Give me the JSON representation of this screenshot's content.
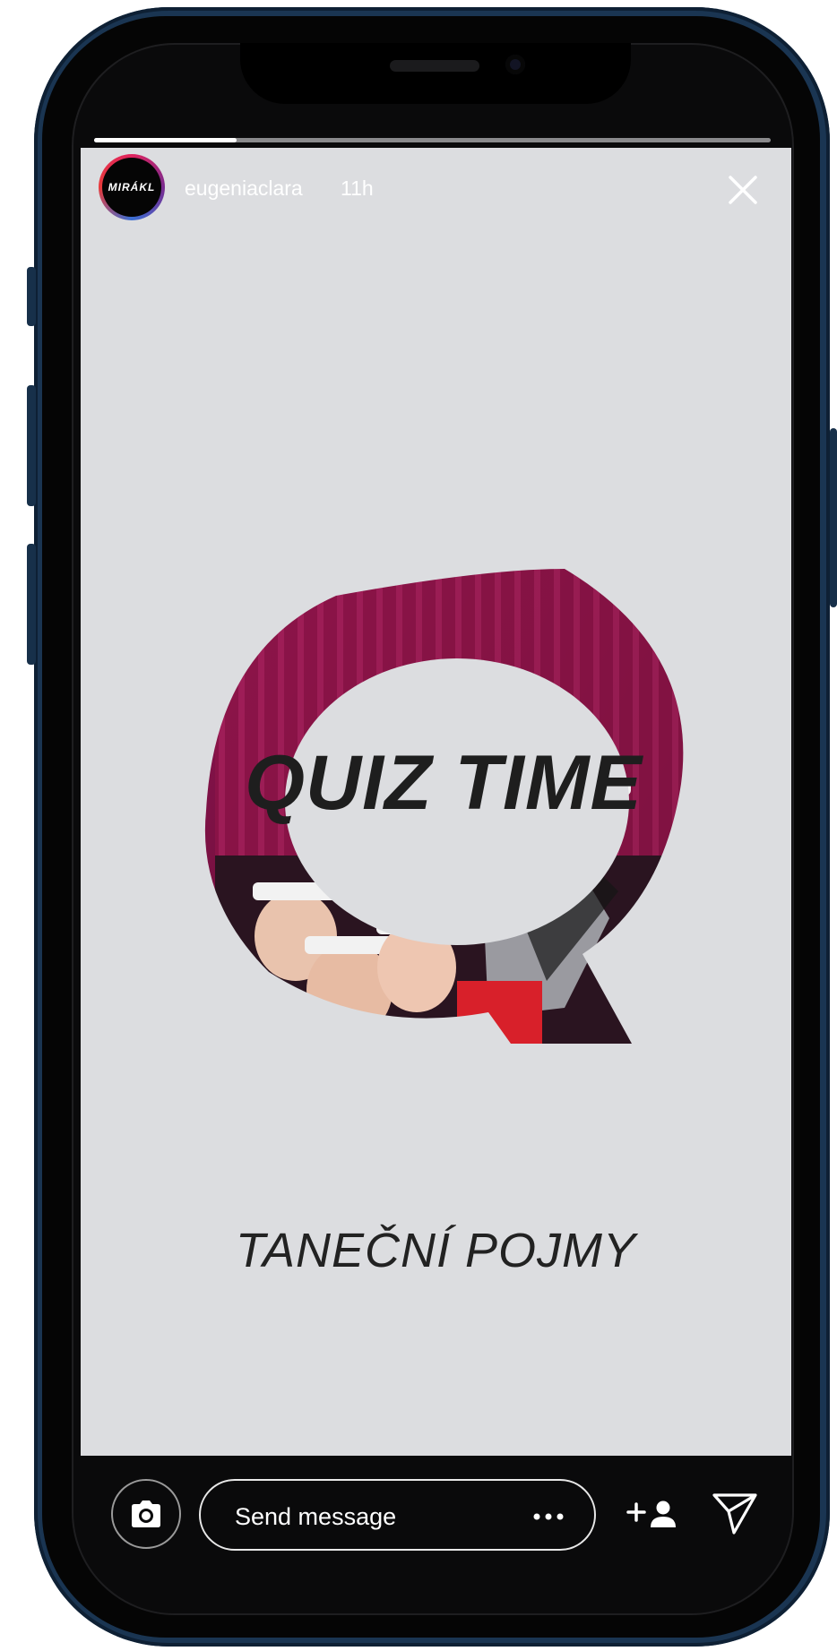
{
  "story": {
    "username": "eugeniaclara",
    "time_ago": "11h",
    "avatar_text": "MIRÁKL",
    "progress": 0.21,
    "title": "QUIZ TIME",
    "subtitle": "TANEČNÍ POJMY"
  },
  "footer": {
    "message_placeholder": "Send message"
  },
  "icons": {
    "close": "close-icon",
    "camera": "camera-icon",
    "more": "more-horizontal-icon",
    "add_friend": "add-friend-icon",
    "send": "send-icon"
  },
  "colors": {
    "story_background": "#dcdde0",
    "q_accent": "#8a1340",
    "phone_frame": "#1a3552"
  }
}
